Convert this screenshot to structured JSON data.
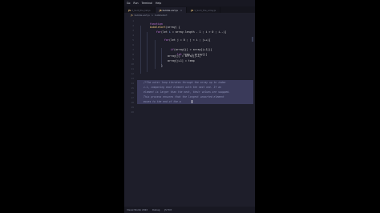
{
  "menubar": {
    "items": [
      "Go",
      "Run",
      "Terminal",
      "Help"
    ]
  },
  "tabs": [
    {
      "icon": "JS",
      "label": "2_Sort_the_list.js"
    },
    {
      "icon": "JS",
      "label": "bubble-sort.js"
    },
    {
      "icon": "JS",
      "label": "1_Sum_the_array.js"
    }
  ],
  "breadcrumb": {
    "file_icon": "JS",
    "file": "bubble-sort.js",
    "separator": ">",
    "symbol": "bubbleSort"
  },
  "editor": {
    "line_numbers": [
      "1",
      "2",
      "3",
      "4",
      "5",
      "6",
      "7",
      "8",
      "9",
      "10",
      "11",
      "12",
      "13",
      "14",
      "15",
      "16",
      "17",
      "18",
      "19",
      "20"
    ],
    "code": {
      "l1_kw": "function",
      "l1_name": "bubbleSort",
      "l1_rest": "(array) {",
      "l3_kw": "for",
      "l3_rest1": "(let ",
      "l3_var": "i",
      "l3_rest2": " = array.length - 1 ; i > 0 ; i--){",
      "l5_kw": "for",
      "l5_rest": "(let j = 0 ; j < i ; j++){",
      "l7_kw": "if",
      "l7_rest": "(array[j] > array[j+1]){",
      "l8_kw": "let",
      "l8_rest": " temp = array[j]",
      "l9": "array[j] = array[j+1]",
      "l10": "array[j+1] = temp",
      "l11": "}"
    },
    "comment_lines": [
      "/*The outer loop iterates through the array up to index",
      "i-1, comparing each element with the next one. If an",
      "element is larger than the next, their values are swapped.",
      "This process ensures that the largest unsorted element",
      "moves to the end of the a"
    ]
  },
  "statusbar": {
    "items": [
      "Visual Studio 2022",
      "Debug",
      "JS Fmt"
    ]
  }
}
